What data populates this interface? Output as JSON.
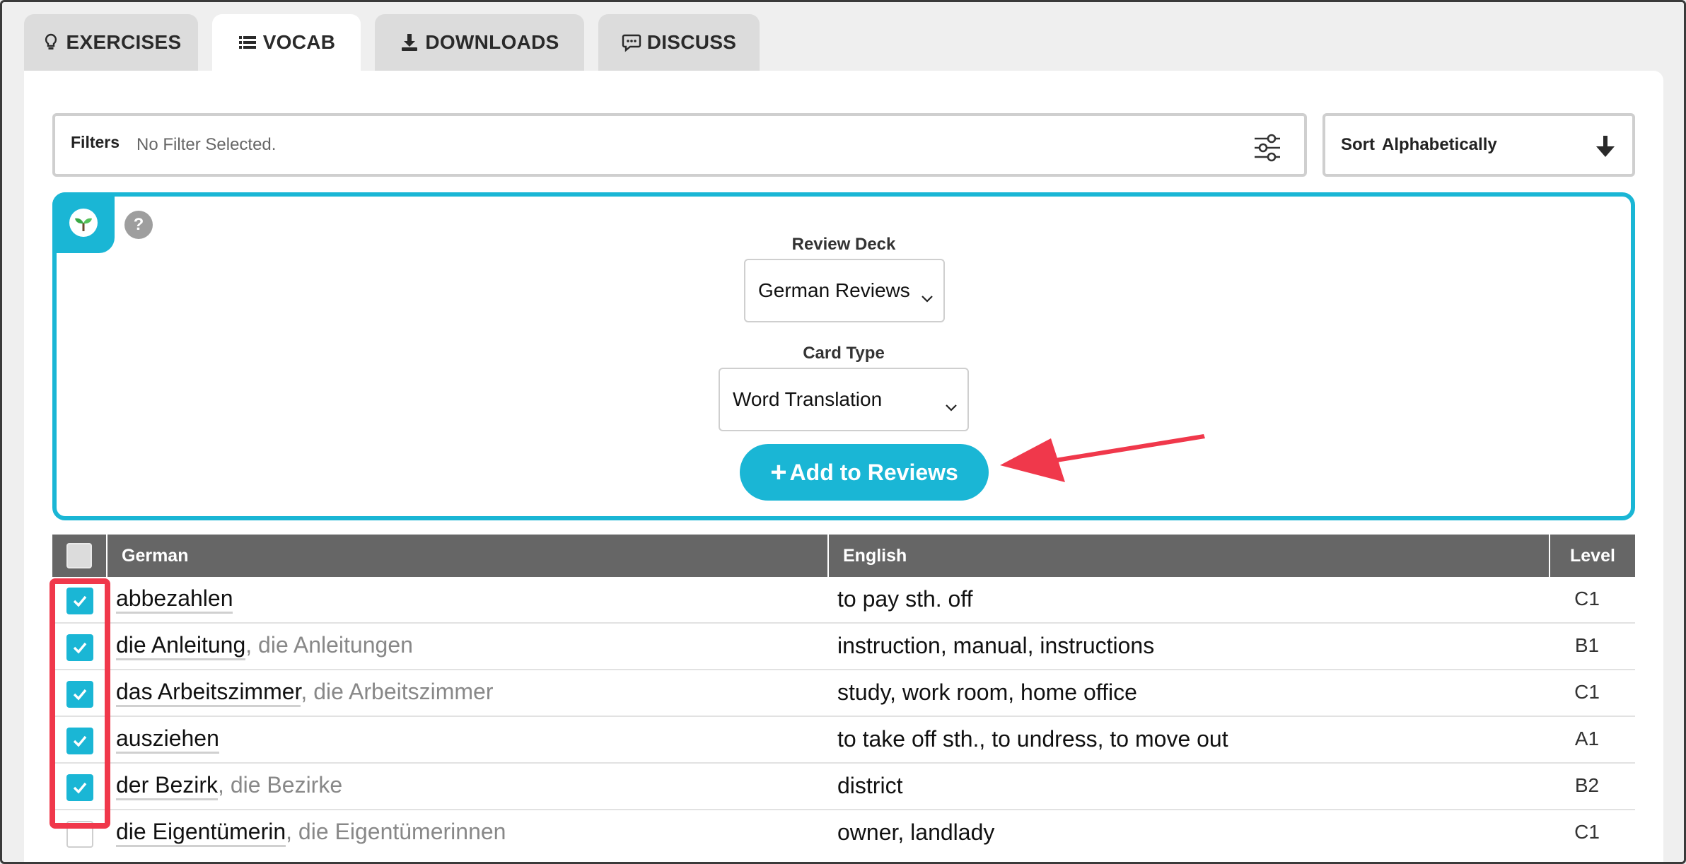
{
  "tabs": [
    {
      "label": "EXERCISES",
      "icon": "lightbulb-icon"
    },
    {
      "label": "VOCAB",
      "icon": "list-icon"
    },
    {
      "label": "DOWNLOADS",
      "icon": "download-icon"
    },
    {
      "label": "DISCUSS",
      "icon": "chat-icon"
    }
  ],
  "filters": {
    "label": "Filters",
    "value": "No Filter Selected."
  },
  "sort": {
    "word1": "Sort",
    "word2": "Alphabetically"
  },
  "review": {
    "help": "?",
    "deck_label": "Review Deck",
    "deck_value": "German Reviews",
    "card_type_label": "Card Type",
    "card_type_value": "Word Translation",
    "add_button": "Add to Reviews"
  },
  "table": {
    "columns": [
      "German",
      "English",
      "Level"
    ],
    "rows": [
      {
        "word": "abbezahlen",
        "plural": "",
        "english": "to pay sth. off",
        "level": "C1",
        "checked": true
      },
      {
        "word": "die Anleitung",
        "plural": ", die Anleitungen",
        "english": "instruction, manual, instructions",
        "level": "B1",
        "checked": true
      },
      {
        "word": "das Arbeitszimmer",
        "plural": ", die Arbeitszimmer",
        "english": "study, work room, home office",
        "level": "C1",
        "checked": true
      },
      {
        "word": "ausziehen",
        "plural": "",
        "english": "to take off sth., to undress, to move out",
        "level": "A1",
        "checked": true
      },
      {
        "word": "der Bezirk",
        "plural": ", die Bezirke",
        "english": "district",
        "level": "B2",
        "checked": true
      },
      {
        "word": "die Eigentümerin",
        "plural": ", die Eigentümerinnen",
        "english": "owner, landlady",
        "level": "C1",
        "checked": false
      }
    ]
  },
  "colors": {
    "accent": "#1ab6d5",
    "annotation": "#f0384b",
    "header": "#666666"
  }
}
